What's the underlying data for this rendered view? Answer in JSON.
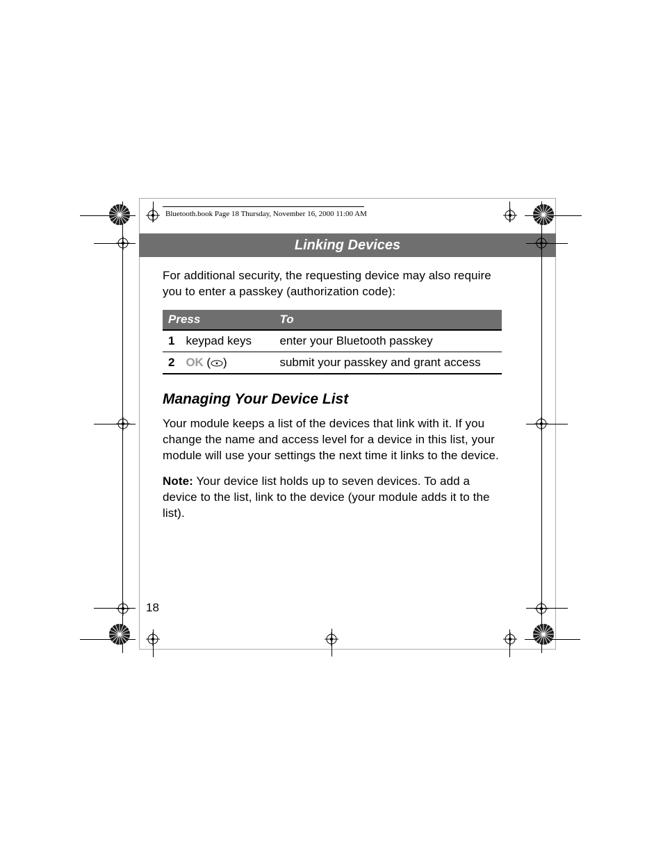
{
  "header": {
    "running_head": "Bluetooth.book  Page 18  Thursday, November 16, 2000  11:00 AM",
    "banner_title": "Linking Devices"
  },
  "intro_para": "For additional security, the requesting device may also require you to enter a passkey (authorization code):",
  "table": {
    "col_press": "Press",
    "col_to": "To",
    "rows": [
      {
        "num": "1",
        "press": "keypad keys",
        "to": "enter your Bluetooth passkey"
      },
      {
        "num": "2",
        "press_label": "OK",
        "press_sym": "(⌕)",
        "to": "submit your passkey and grant access"
      }
    ]
  },
  "section_heading": "Managing Your Device List",
  "section_para": "Your module keeps a list of the devices that link with it. If you change the name and access level for a device in this list, your module will use your settings the next time it links to the device.",
  "note_label": "Note:",
  "note_text": " Your device list holds up to seven devices. To add a device to the list, link to the device (your module adds it to the list).",
  "page_number": "18"
}
